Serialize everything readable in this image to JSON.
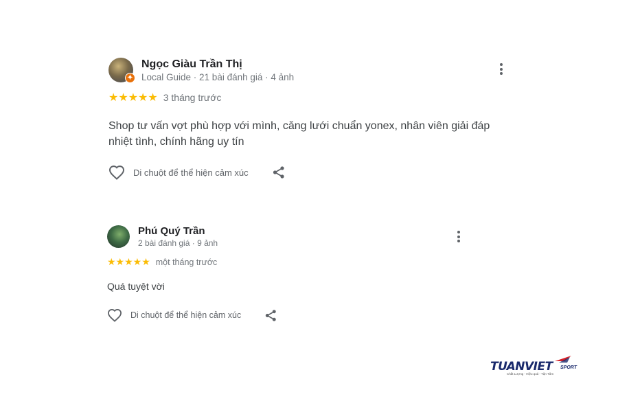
{
  "reviews": [
    {
      "name": "Ngọc Giàu Trần Thị",
      "subtitle": "Local Guide · 21 bài đánh giá · 4 ảnh",
      "stars": "★★★★★",
      "rating": 5,
      "time": "3 tháng trước",
      "text_line1": "Shop tư vấn vợt phù hợp với mình, căng lưới chuẩn yonex, nhân viên giải đáp",
      "text_line2": "nhiệt tình, chính hãng uy tín",
      "reaction_label": "Di chuột để thể hiện cảm xúc",
      "local_guide_badge": true
    },
    {
      "name": "Phú Quý Trần",
      "subtitle": "2 bài đánh giá · 9 ảnh",
      "stars": "★★★★★",
      "rating": 5,
      "time": "một tháng trước",
      "text_line1": "Quá tuyệt vời",
      "reaction_label": "Di chuột để thể hiện cảm xúc"
    }
  ],
  "logo": {
    "text": "TUANVIET",
    "sub": "SPORT",
    "tagline": "Chất Lượng - Hiệu quả - Tận Tâm"
  },
  "colors": {
    "star": "#fbbc04",
    "text": "#202124",
    "muted": "#70757a",
    "badge": "#e8710a",
    "logo_blue": "#1a2a6c",
    "logo_red": "#d62027"
  },
  "icons": [
    "heart-icon",
    "share-icon",
    "more-vert-icon",
    "local-guide-badge-icon"
  ]
}
